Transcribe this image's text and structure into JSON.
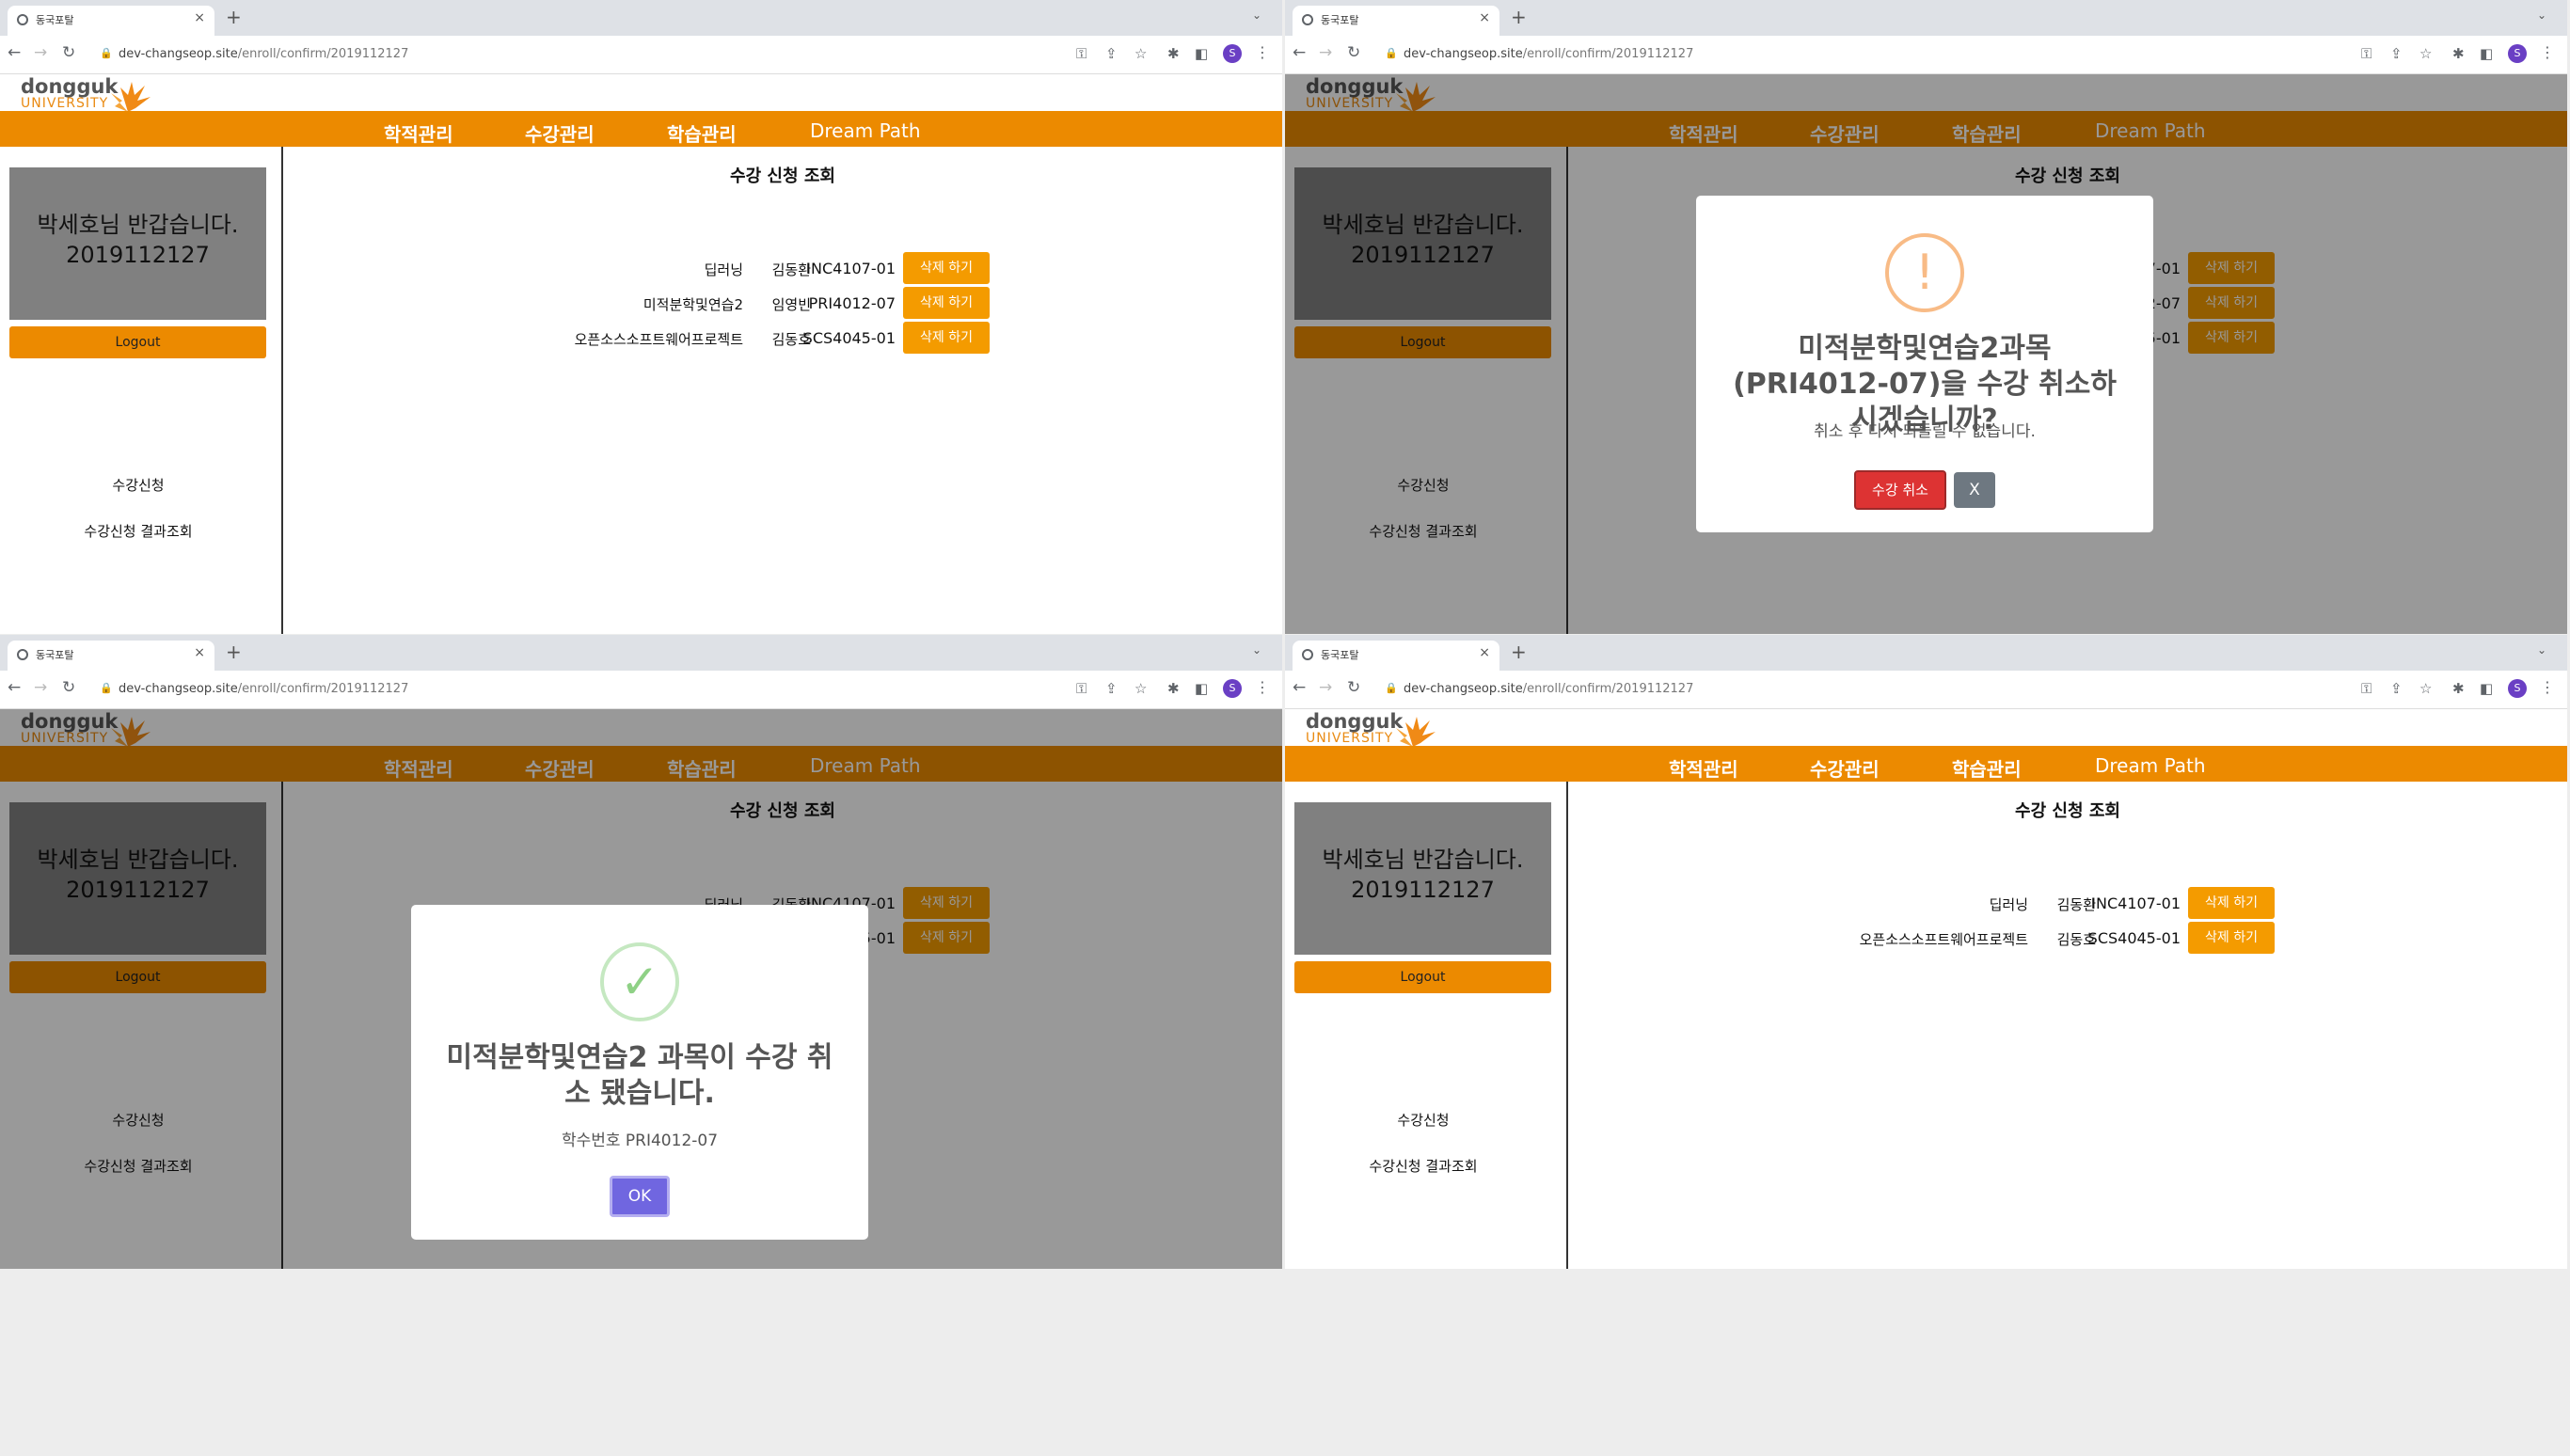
{
  "browser": {
    "tab_title": "동국포탈",
    "tab_close": "×",
    "new_tab": "+",
    "url_host": "dev-changseop.site",
    "url_path": "/enroll/confirm/2019112127",
    "avatar_letter": "S"
  },
  "site": {
    "logo_top": "dongguk",
    "logo_bottom": "UNIVERSITY",
    "nav": [
      "학적관리",
      "수강관리",
      "학습관리",
      "Dream Path"
    ],
    "greeting_line1": "박세호님 반갑습니다.",
    "greeting_line2": "2019112127",
    "logout_label": "Logout",
    "side_links": [
      "수강신청",
      "수강신청 결과조회"
    ],
    "main_title": "수강 신청 조회",
    "delete_label": "삭제 하기"
  },
  "courses_before": [
    {
      "name": "딥러닝",
      "professor": "김동환",
      "code": "INC4107-01"
    },
    {
      "name": "미적분학및연습2",
      "professor": "임영빈",
      "code": "PRI4012-07"
    },
    {
      "name": "오픈소스소프트웨어프로젝트",
      "professor": "김동호",
      "code": "SCS4045-01"
    }
  ],
  "courses_after": [
    {
      "name": "딥러닝",
      "professor": "김동환",
      "code": "INC4107-01"
    },
    {
      "name": "오픈소스소프트웨어프로젝트",
      "professor": "김동호",
      "code": "SCS4045-01"
    }
  ],
  "confirm_modal": {
    "icon": "!",
    "title": "미적분학및연습2과목 (PRI4012-07)을 수강 취소하시겠습니까?",
    "text": "취소 후 다시 되돌릴 수 없습니다.",
    "confirm_label": "수강 취소",
    "close_label": "X"
  },
  "success_modal": {
    "icon": "✓",
    "title": "미적분학및연습2 과목이 수강 취소 됐습니다.",
    "text": "학수번호 PRI4012-07",
    "ok_label": "OK"
  },
  "colors": {
    "nav_orange": "#ec8a00",
    "delete_orange": "#f49b00",
    "cancel_red": "#dd3333",
    "ok_purple": "#7066e0"
  }
}
